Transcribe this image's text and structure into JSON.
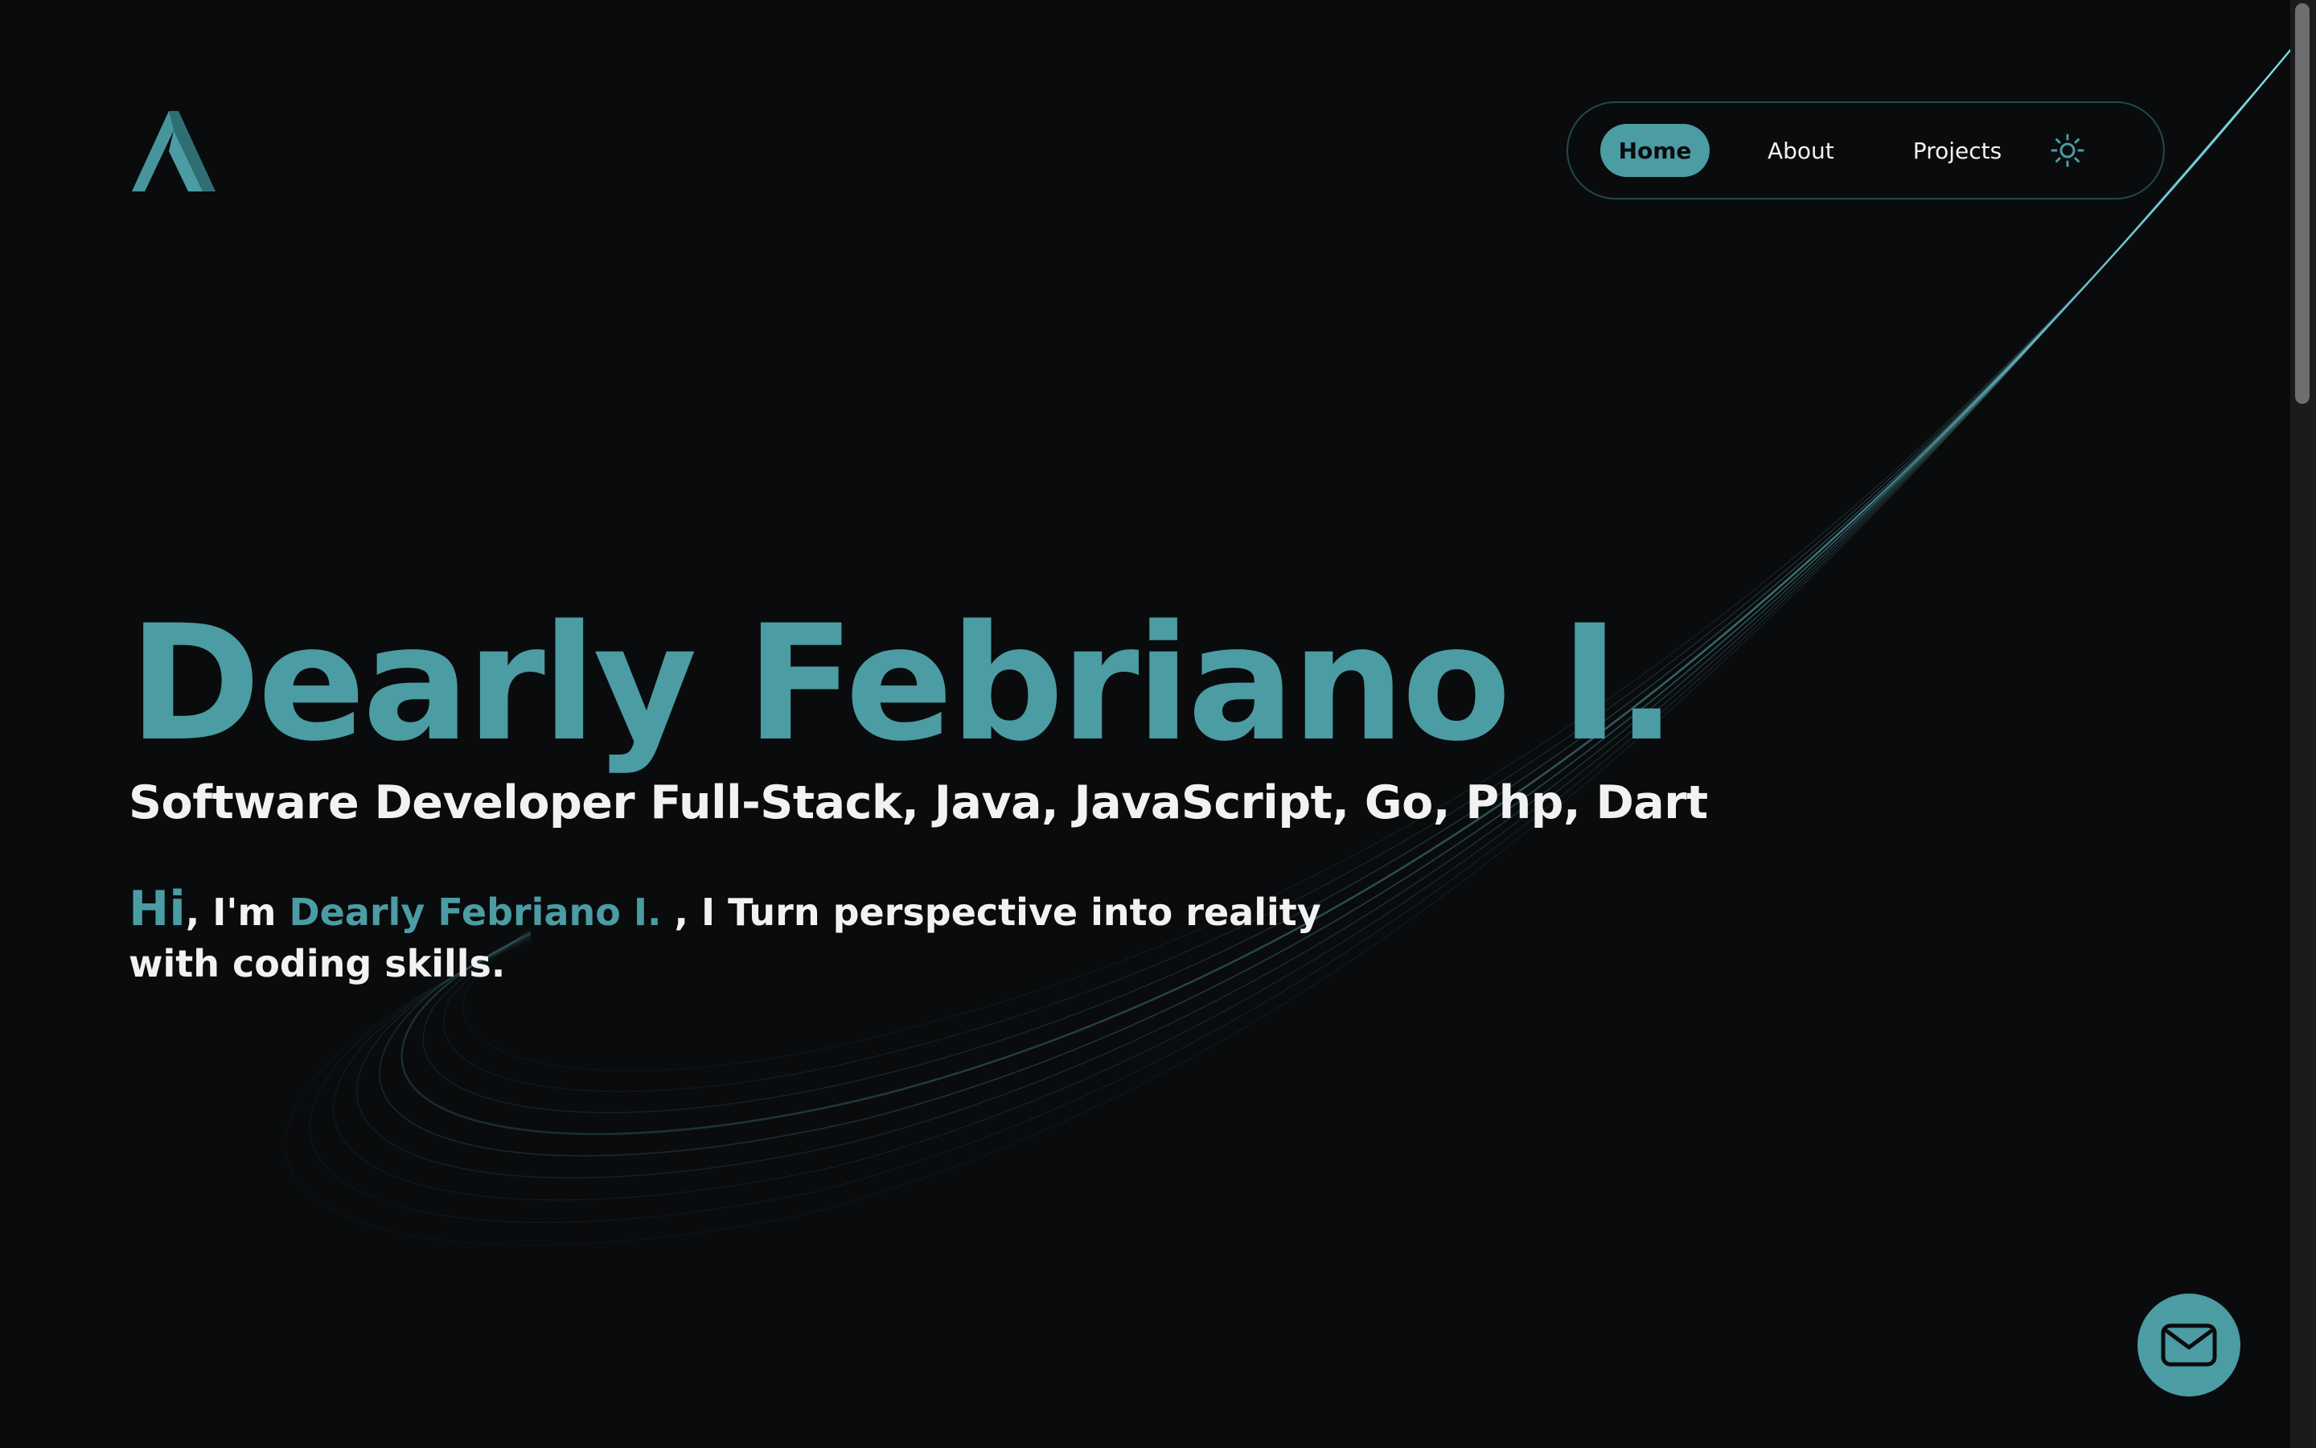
{
  "nav": {
    "items": [
      {
        "label": "Home",
        "active": true
      },
      {
        "label": "About",
        "active": false
      },
      {
        "label": "Projects",
        "active": false
      }
    ],
    "theme_toggle_icon": "sun-icon"
  },
  "hero": {
    "name": "Dearly Febriano I.",
    "role": "Software Developer Full-Stack, Java, JavaScript, Go, Php, Dart",
    "intro": {
      "greeting": "Hi",
      "comma": ",",
      "im": " I'm ",
      "name": "Dearly Febriano I.",
      "rest": " , I Turn perspective into reality with coding skills."
    }
  },
  "fab": {
    "icon": "mail-icon"
  },
  "colors": {
    "background": "#0a0b0d",
    "accent": "#4b9ca3",
    "text": "#f2f2f2",
    "nav_border": "#1f4a4d"
  }
}
